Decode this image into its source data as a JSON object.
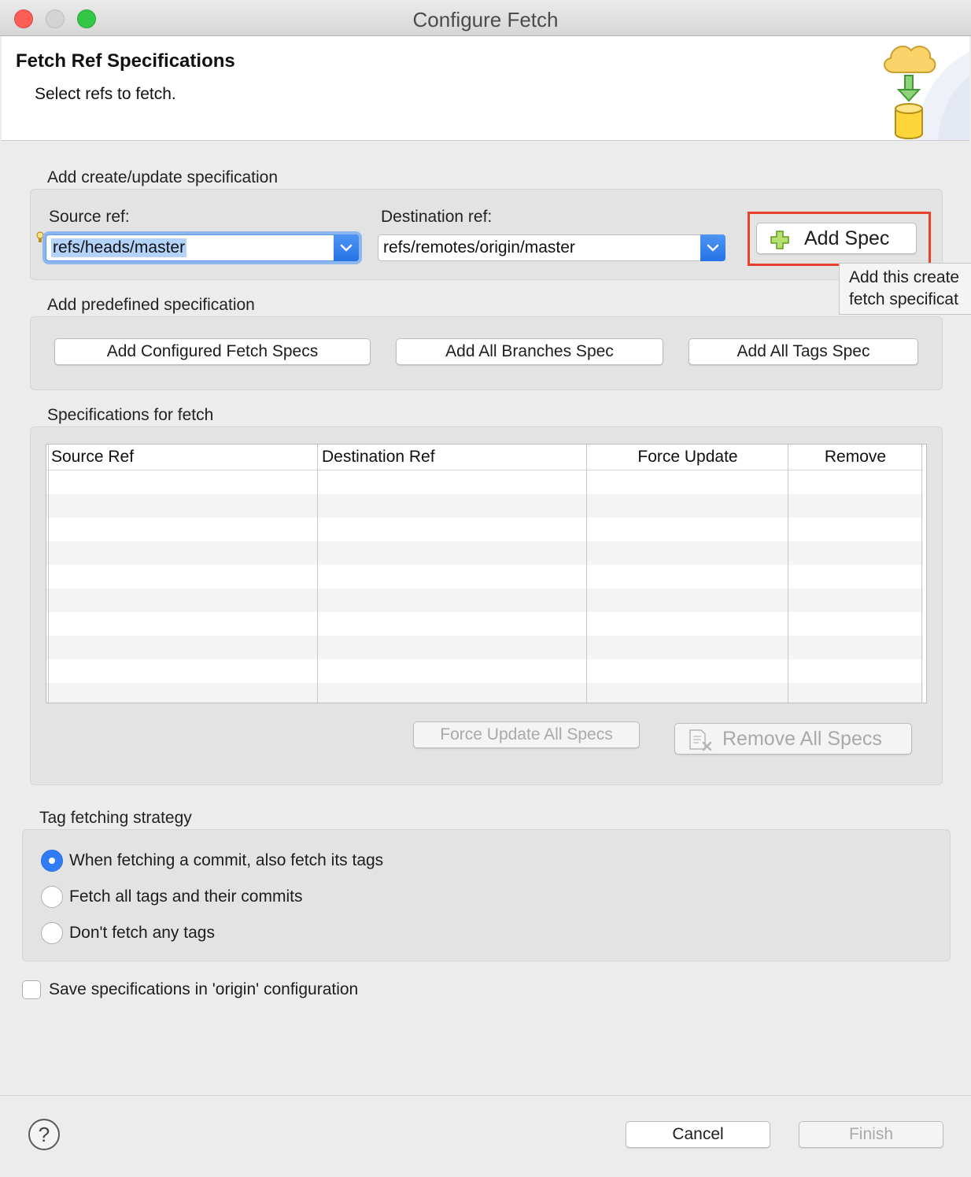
{
  "window": {
    "title": "Configure Fetch"
  },
  "header": {
    "title": "Fetch Ref Specifications",
    "subtitle": "Select refs to fetch."
  },
  "create_update": {
    "section_label": "Add create/update specification",
    "source_label": "Source ref:",
    "source_value": "refs/heads/master",
    "destination_label": "Destination ref:",
    "destination_value": "refs/remotes/origin/master",
    "add_spec_label": "Add Spec",
    "tooltip_line1": "Add this create",
    "tooltip_line2": "fetch specificat"
  },
  "predefined": {
    "section_label": "Add predefined specification",
    "buttons": [
      "Add Configured Fetch Specs",
      "Add All Branches Spec",
      "Add All Tags Spec"
    ]
  },
  "specs": {
    "section_label": "Specifications for fetch",
    "columns": [
      "Source Ref",
      "Destination Ref",
      "Force Update",
      "Remove"
    ],
    "rows": [],
    "force_update_all_label": "Force Update All Specs",
    "remove_all_label": "Remove All Specs"
  },
  "tag_strategy": {
    "section_label": "Tag fetching strategy",
    "options": [
      "When fetching a commit, also fetch its tags",
      "Fetch all tags and their commits",
      "Don't fetch any tags"
    ],
    "selected_index": 0
  },
  "save_config": {
    "label": "Save specifications in 'origin' configuration",
    "checked": false
  },
  "footer": {
    "help_glyph": "?",
    "cancel_label": "Cancel",
    "finish_label": "Finish"
  },
  "colors": {
    "accent": "#2f7cf6",
    "highlight": "#e8412c"
  },
  "icons": {
    "header": "cloud-to-database-icon",
    "add_spec": "green-plus-icon",
    "remove_all": "document-remove-icon",
    "combo_arrow": "chevron-down-icon",
    "help": "help-icon"
  }
}
